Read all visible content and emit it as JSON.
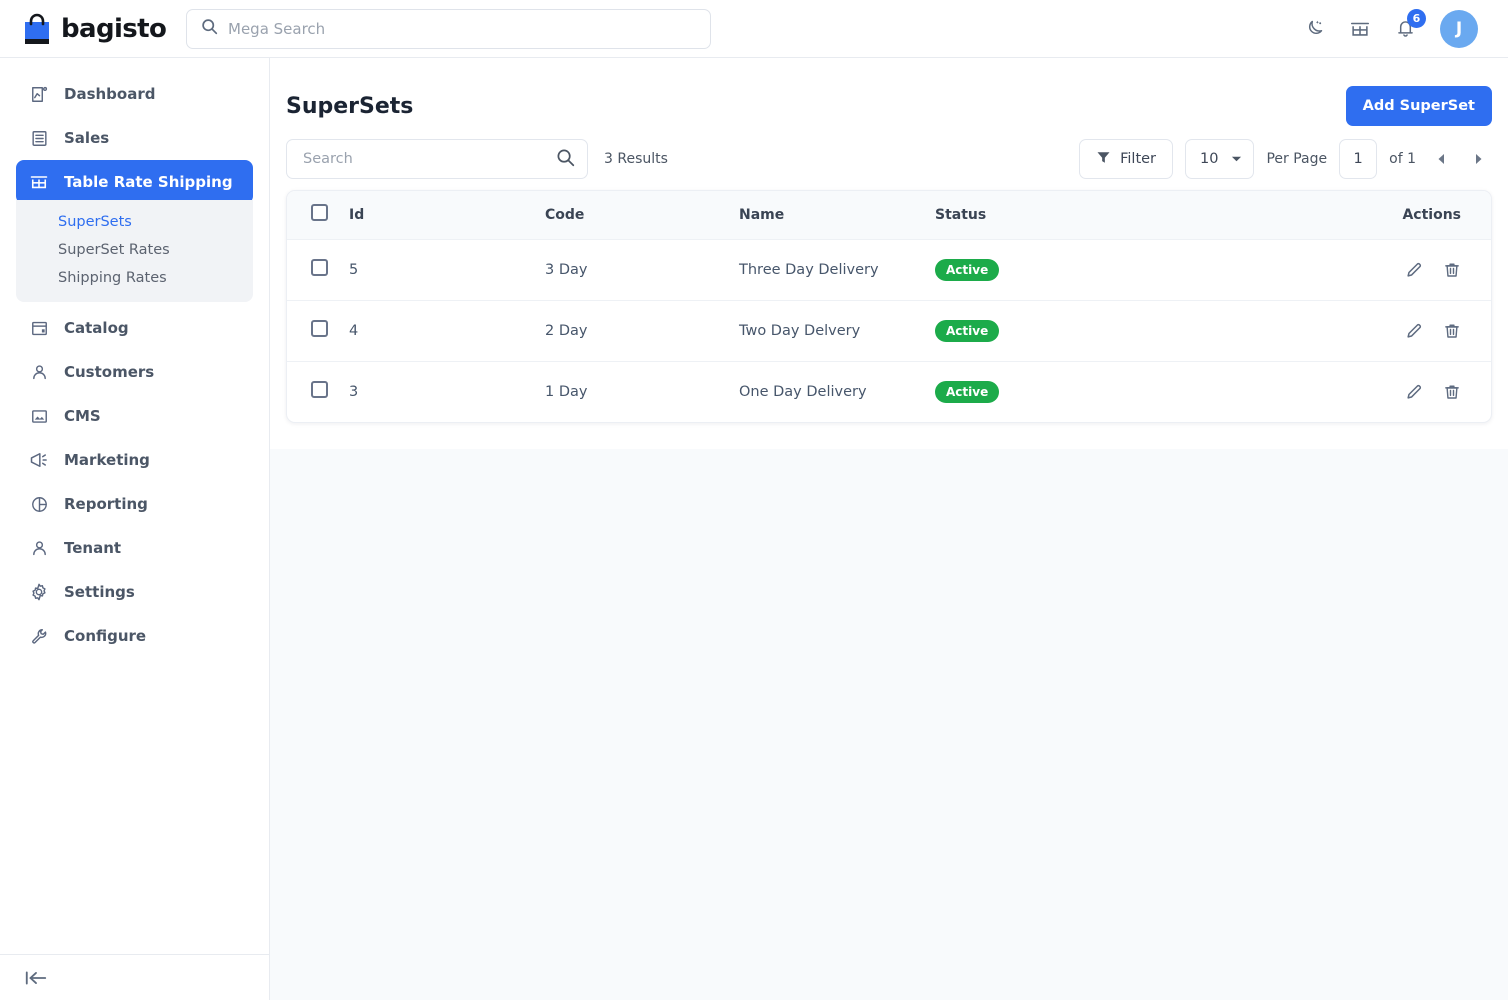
{
  "header": {
    "brand": "bagisto",
    "brand_icon": "shopping-bag-icon",
    "search": {
      "placeholder": "Mega Search",
      "value": "",
      "icon": "search-icon"
    },
    "dark_mode_icon": "moon-icon",
    "store_icon": "store-front-icon",
    "notifications_icon": "bell-icon",
    "notifications_count": "6",
    "avatar_initial": "J"
  },
  "sidebar": {
    "items": [
      {
        "label": "Dashboard",
        "icon": "dashboard-chart-icon",
        "active": false
      },
      {
        "label": "Sales",
        "icon": "invoice-list-icon",
        "active": false
      },
      {
        "label": "Table Rate Shipping",
        "icon": "store-front-icon",
        "active": true
      },
      {
        "label": "Catalog",
        "icon": "catalog-box-icon",
        "active": false
      },
      {
        "label": "Customers",
        "icon": "user-icon",
        "active": false
      },
      {
        "label": "CMS",
        "icon": "image-frame-icon",
        "active": false
      },
      {
        "label": "Marketing",
        "icon": "megaphone-icon",
        "active": false
      },
      {
        "label": "Reporting",
        "icon": "pie-chart-icon",
        "active": false
      },
      {
        "label": "Tenant",
        "icon": "user-icon",
        "active": false
      },
      {
        "label": "Settings",
        "icon": "gear-icon",
        "active": false
      },
      {
        "label": "Configure",
        "icon": "wrench-icon",
        "active": false
      }
    ],
    "submenu": [
      {
        "label": "SuperSets",
        "active": true
      },
      {
        "label": "SuperSet Rates",
        "active": false
      },
      {
        "label": "Shipping Rates",
        "active": false
      }
    ],
    "collapse_icon": "collapse-sidebar-icon"
  },
  "page": {
    "title": "SuperSets",
    "add_button": "Add SuperSet"
  },
  "toolbar": {
    "search_placeholder": "Search",
    "search_value": "",
    "search_icon": "search-icon",
    "results_text": "3 Results",
    "filter_label": "Filter",
    "filter_icon": "funnel-icon",
    "per_page_value": "10",
    "per_page_label": "Per Page",
    "page_value": "1",
    "of_label": "of 1",
    "prev_icon": "chevron-left-icon",
    "next_icon": "chevron-right-icon"
  },
  "table": {
    "columns": [
      "Id",
      "Code",
      "Name",
      "Status",
      "Actions"
    ],
    "rows": [
      {
        "id": "5",
        "code": "3 Day",
        "name": "Three Day Delivery",
        "status": "Active"
      },
      {
        "id": "4",
        "code": "2 Day",
        "name": "Two Day Delvery",
        "status": "Active"
      },
      {
        "id": "3",
        "code": "1 Day",
        "name": "One Day Delivery",
        "status": "Active"
      }
    ],
    "edit_icon": "pencil-icon",
    "delete_icon": "trash-icon"
  },
  "colors": {
    "accent": "#2f6ef0",
    "status_active": "#1cab4a",
    "page_bg": "#f8fafc",
    "avatar": "#6aa9f0"
  }
}
